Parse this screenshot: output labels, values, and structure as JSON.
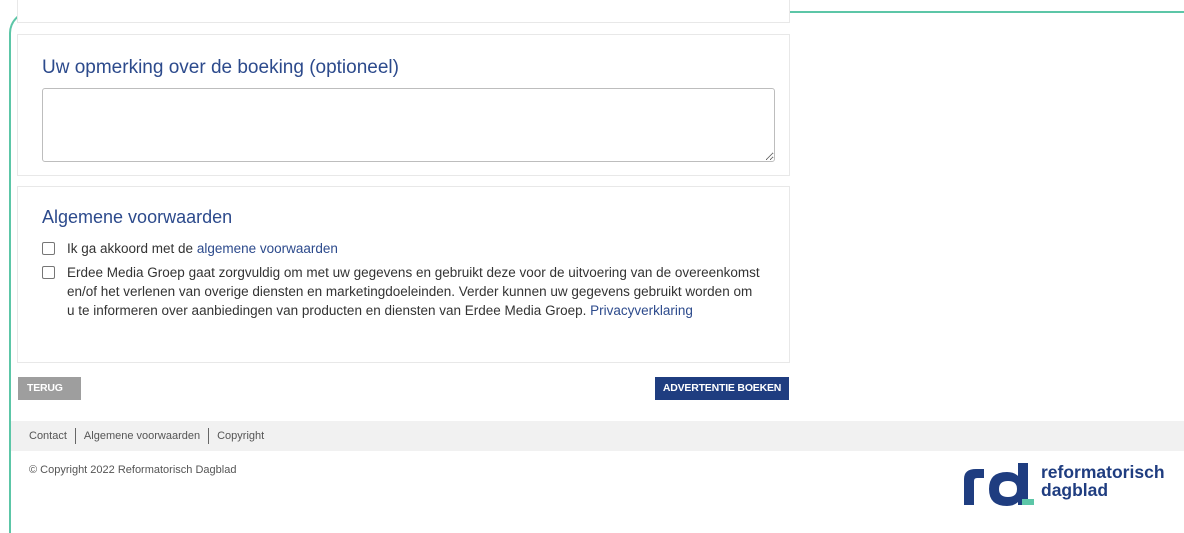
{
  "remark_section": {
    "title": "Uw opmerking over de boeking (optioneel)",
    "textarea_value": ""
  },
  "terms_section": {
    "title": "Algemene voorwaarden",
    "agree_prefix": "Ik ga akkoord met de ",
    "agree_link": "algemene voorwaarden",
    "privacy_text": "Erdee Media Groep gaat zorgvuldig om met uw gegevens en gebruikt deze voor de uitvoering van de overeenkomst en/of het verlenen van overige diensten en marketingdoeleinden. Verder kunnen uw gegevens gebruikt worden om u te informeren over aanbiedingen van producten en diensten van Erdee Media Groep. ",
    "privacy_link": "Privacyverklaring"
  },
  "buttons": {
    "back": "TERUG",
    "book": "ADVERTENTIE BOEKEN"
  },
  "footer": {
    "links": [
      "Contact",
      "Algemene voorwaarden",
      "Copyright"
    ],
    "copyright": "© Copyright 2022 Reformatorisch Dagblad"
  },
  "logo": {
    "line1": "reformatorisch",
    "line2": "dagblad",
    "colors": {
      "brand": "#1f3d80",
      "accent": "#5cc6a7"
    }
  }
}
